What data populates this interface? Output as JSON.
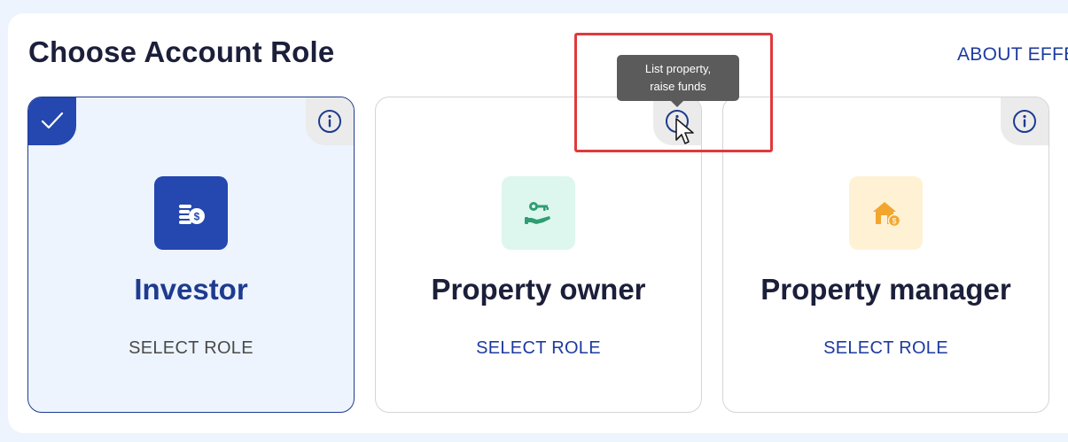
{
  "page": {
    "title": "Choose Account Role",
    "about_link": "ABOUT EFFE"
  },
  "roles": [
    {
      "title": "Investor",
      "action": "SELECT ROLE",
      "selected": true,
      "icon": "coins-dollar-icon",
      "tile_color": "#2447b0"
    },
    {
      "title": "Property owner",
      "action": "SELECT ROLE",
      "selected": false,
      "icon": "hand-key-icon",
      "tile_color": "#ddf7ee"
    },
    {
      "title": "Property manager",
      "action": "SELECT ROLE",
      "selected": false,
      "icon": "house-dollar-icon",
      "tile_color": "#fff1d4"
    }
  ],
  "tooltip": {
    "line1": "List property,",
    "line2": "raise funds"
  },
  "colors": {
    "accent": "#2447b0",
    "link": "#1d3aa0",
    "highlight": "#e0393b"
  }
}
